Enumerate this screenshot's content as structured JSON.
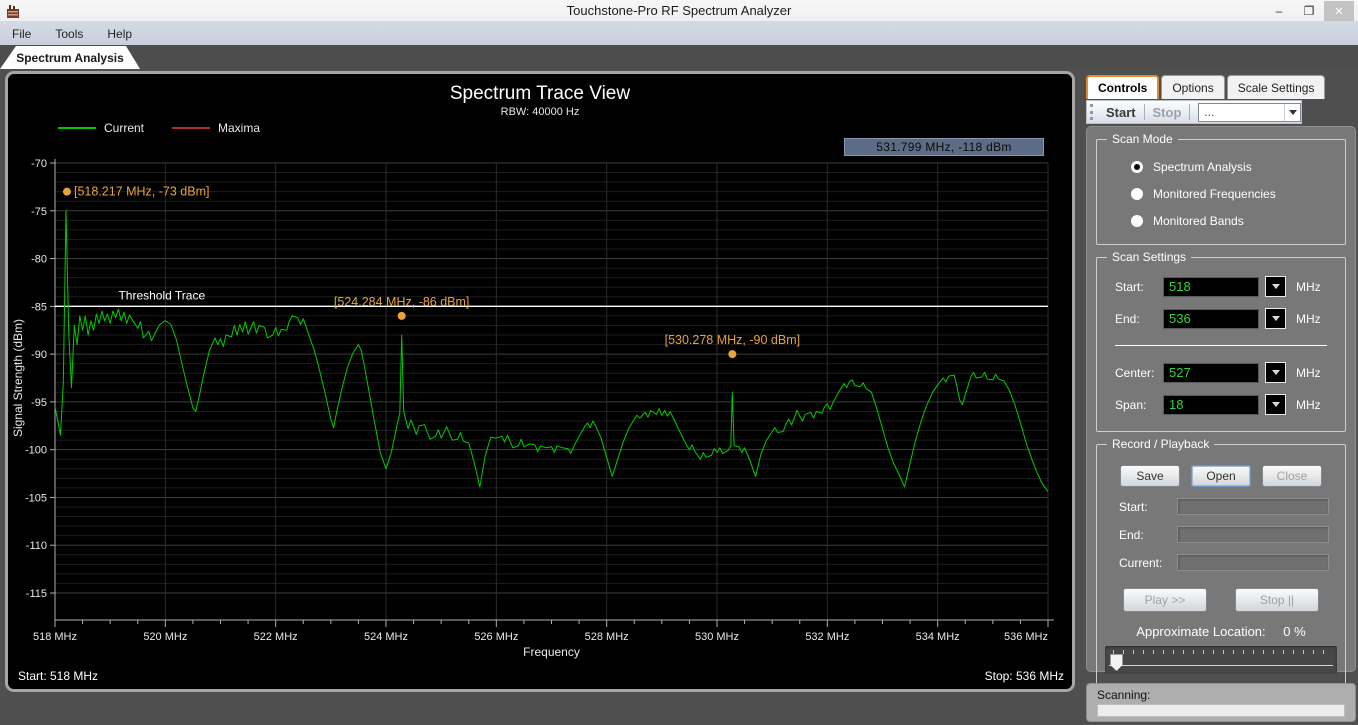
{
  "window": {
    "title": "Touchstone-Pro RF Spectrum Analyzer",
    "controls": {
      "minimize": "–",
      "restore": "❐",
      "close": "✕"
    }
  },
  "menu": {
    "items": [
      "File",
      "Tools",
      "Help"
    ]
  },
  "main_tab": "Spectrum Analysis",
  "chart_data": {
    "type": "line",
    "title": "Spectrum Trace View",
    "subtitle": "RBW: 40000 Hz",
    "xlabel": "Frequency",
    "ylabel": "Signal Strength (dBm)",
    "x_unit": "MHz",
    "xlim": [
      518,
      536
    ],
    "ylim": [
      -115,
      -70
    ],
    "x_major_tick": 2,
    "x_minor_tick": 0.5,
    "y_major_tick": 5,
    "y_minor_tick": 1,
    "grid": true,
    "legend_position": "top-left",
    "legend": [
      {
        "label": "Current",
        "color": "#00c800"
      },
      {
        "label": "Maxima",
        "color": "#a83232"
      }
    ],
    "cursor_readout": "531.799 MHz,  -118 dBm",
    "start_text": "Start: 518 MHz",
    "stop_text": "Stop: 536 MHz",
    "annotation_color": "#e8a33c",
    "annotations": [
      {
        "text": "[518.217 MHz, -73 dBm]",
        "x": 518.217,
        "y": -73,
        "placement": "right"
      },
      {
        "text": "[524.284 MHz, -86 dBm]",
        "x": 524.284,
        "y": -86,
        "placement": "above"
      },
      {
        "text": "[530.278 MHz, -90 dBm]",
        "x": 530.278,
        "y": -90,
        "placement": "above"
      }
    ],
    "threshold": {
      "label": "Threshold Trace",
      "value": -85,
      "color": "#ffffff",
      "label_x": 519.15
    },
    "series": [
      {
        "name": "Current",
        "color": "#00cc00",
        "points": [
          [
            518.0,
            -95.5
          ],
          [
            518.05,
            -97
          ],
          [
            518.1,
            -98.5
          ],
          [
            518.15,
            -93
          ],
          [
            518.2,
            -75
          ],
          [
            518.25,
            -88
          ],
          [
            518.3,
            -93.5
          ],
          [
            518.35,
            -87
          ],
          [
            518.4,
            -89
          ],
          [
            518.45,
            -86
          ],
          [
            518.5,
            -87.5
          ],
          [
            518.55,
            -86
          ],
          [
            518.6,
            -88
          ],
          [
            518.65,
            -86.5
          ],
          [
            518.7,
            -87.5
          ],
          [
            518.75,
            -85.8
          ],
          [
            518.8,
            -86.8
          ],
          [
            518.85,
            -85.5
          ],
          [
            518.9,
            -86.5
          ],
          [
            518.95,
            -85.8
          ],
          [
            519.0,
            -86.8
          ],
          [
            519.05,
            -85.5
          ],
          [
            519.1,
            -86.2
          ],
          [
            519.15,
            -85.3
          ],
          [
            519.2,
            -86.5
          ],
          [
            519.25,
            -85.6
          ],
          [
            519.3,
            -86.8
          ],
          [
            519.35,
            -85.9
          ],
          [
            519.4,
            -86.4
          ],
          [
            519.5,
            -87.3
          ],
          [
            519.55,
            -86.6
          ],
          [
            519.6,
            -88.3
          ],
          [
            519.7,
            -87.6
          ],
          [
            519.75,
            -88.6
          ],
          [
            519.85,
            -87.4
          ],
          [
            519.9,
            -86.9
          ],
          [
            520.0,
            -86.5
          ],
          [
            520.1,
            -86.9
          ],
          [
            520.2,
            -88.5
          ],
          [
            520.3,
            -91
          ],
          [
            520.4,
            -93.4
          ],
          [
            520.5,
            -95.6
          ],
          [
            520.55,
            -96
          ],
          [
            520.6,
            -94.8
          ],
          [
            520.7,
            -92
          ],
          [
            520.8,
            -89.6
          ],
          [
            520.9,
            -88.3
          ],
          [
            520.95,
            -89
          ],
          [
            521.0,
            -88.4
          ],
          [
            521.05,
            -89.2
          ],
          [
            521.1,
            -88
          ],
          [
            521.2,
            -88.2
          ],
          [
            521.25,
            -87
          ],
          [
            521.3,
            -88
          ],
          [
            521.35,
            -86.9
          ],
          [
            521.4,
            -87.7
          ],
          [
            521.45,
            -86.6
          ],
          [
            521.5,
            -87.9
          ],
          [
            521.6,
            -86.6
          ],
          [
            521.65,
            -87.8
          ],
          [
            521.7,
            -87
          ],
          [
            521.8,
            -87.2
          ],
          [
            521.85,
            -88.3
          ],
          [
            521.95,
            -88
          ],
          [
            522.0,
            -87.2
          ],
          [
            522.05,
            -88.1
          ],
          [
            522.1,
            -87.4
          ],
          [
            522.2,
            -87.5
          ],
          [
            522.25,
            -86.5
          ],
          [
            522.3,
            -86
          ],
          [
            522.4,
            -86.2
          ],
          [
            522.45,
            -86.9
          ],
          [
            522.5,
            -86.3
          ],
          [
            522.6,
            -88
          ],
          [
            522.7,
            -89.6
          ],
          [
            522.8,
            -91.8
          ],
          [
            522.9,
            -94.2
          ],
          [
            523.0,
            -96.8
          ],
          [
            523.05,
            -97.7
          ],
          [
            523.1,
            -96.2
          ],
          [
            523.2,
            -93.6
          ],
          [
            523.3,
            -91.4
          ],
          [
            523.4,
            -89.9
          ],
          [
            523.5,
            -89
          ],
          [
            523.55,
            -89.6
          ],
          [
            523.6,
            -91
          ],
          [
            523.7,
            -94.2
          ],
          [
            523.8,
            -97.4
          ],
          [
            523.9,
            -100.4
          ],
          [
            524.0,
            -102
          ],
          [
            524.1,
            -100.2
          ],
          [
            524.2,
            -97.4
          ],
          [
            524.25,
            -96.2
          ],
          [
            524.284,
            -88
          ],
          [
            524.32,
            -96
          ],
          [
            524.4,
            -97.8
          ],
          [
            524.45,
            -96.9
          ],
          [
            524.5,
            -97.6
          ],
          [
            524.55,
            -98.4
          ],
          [
            524.6,
            -97.5
          ],
          [
            524.7,
            -97.4
          ],
          [
            524.75,
            -98.2
          ],
          [
            524.8,
            -98.9
          ],
          [
            524.9,
            -98.6
          ],
          [
            524.95,
            -97.9
          ],
          [
            525.0,
            -98.8
          ],
          [
            525.1,
            -97.6
          ],
          [
            525.2,
            -99
          ],
          [
            525.3,
            -98.9
          ],
          [
            525.35,
            -98.2
          ],
          [
            525.4,
            -99.1
          ],
          [
            525.5,
            -99.3
          ],
          [
            525.6,
            -101.4
          ],
          [
            525.7,
            -103.9
          ],
          [
            525.8,
            -100.6
          ],
          [
            525.9,
            -98.7
          ],
          [
            526.0,
            -98.8
          ],
          [
            526.1,
            -98.6
          ],
          [
            526.15,
            -99.2
          ],
          [
            526.2,
            -98.5
          ],
          [
            526.3,
            -99.8
          ],
          [
            526.4,
            -99.6
          ],
          [
            526.45,
            -98.9
          ],
          [
            526.5,
            -99.7
          ],
          [
            526.6,
            -99.4
          ],
          [
            526.7,
            -99.5
          ],
          [
            526.75,
            -100.2
          ],
          [
            526.8,
            -99.6
          ],
          [
            526.9,
            -99.8
          ],
          [
            527.0,
            -99.7
          ],
          [
            527.05,
            -100.3
          ],
          [
            527.1,
            -99.6
          ],
          [
            527.2,
            -99.8
          ],
          [
            527.3,
            -99.9
          ],
          [
            527.35,
            -100.4
          ],
          [
            527.4,
            -99.7
          ],
          [
            527.5,
            -98.6
          ],
          [
            527.6,
            -97.6
          ],
          [
            527.65,
            -97.2
          ],
          [
            527.7,
            -97.7
          ],
          [
            527.75,
            -97
          ],
          [
            527.8,
            -97.5
          ],
          [
            527.9,
            -98.8
          ],
          [
            528.0,
            -100.8
          ],
          [
            528.1,
            -102.8
          ],
          [
            528.2,
            -101
          ],
          [
            528.3,
            -99.2
          ],
          [
            528.4,
            -97.8
          ],
          [
            528.5,
            -96.8
          ],
          [
            528.55,
            -96.4
          ],
          [
            528.6,
            -96.7
          ],
          [
            528.7,
            -96.1
          ],
          [
            528.75,
            -96.6
          ],
          [
            528.8,
            -95.9
          ],
          [
            528.9,
            -96.3
          ],
          [
            528.95,
            -95.7
          ],
          [
            529.0,
            -96.4
          ],
          [
            529.05,
            -95.9
          ],
          [
            529.1,
            -96.5
          ],
          [
            529.15,
            -96
          ],
          [
            529.2,
            -96.6
          ],
          [
            529.3,
            -97.8
          ],
          [
            529.4,
            -99
          ],
          [
            529.5,
            -100
          ],
          [
            529.55,
            -99.5
          ],
          [
            529.6,
            -100.2
          ],
          [
            529.7,
            -101
          ],
          [
            529.75,
            -100.3
          ],
          [
            529.8,
            -100.8
          ],
          [
            529.9,
            -100.6
          ],
          [
            529.95,
            -99.9
          ],
          [
            530.0,
            -100.3
          ],
          [
            530.05,
            -99.8
          ],
          [
            530.1,
            -100.4
          ],
          [
            530.2,
            -100.1
          ],
          [
            530.25,
            -99.6
          ],
          [
            530.278,
            -94
          ],
          [
            530.31,
            -99.6
          ],
          [
            530.4,
            -99.7
          ],
          [
            530.45,
            -100.3
          ],
          [
            530.5,
            -99.8
          ],
          [
            530.6,
            -101.2
          ],
          [
            530.7,
            -102.8
          ],
          [
            530.8,
            -100.4
          ],
          [
            530.9,
            -99
          ],
          [
            531.0,
            -98.1
          ],
          [
            531.05,
            -97.7
          ],
          [
            531.1,
            -98.2
          ],
          [
            531.2,
            -98.1
          ],
          [
            531.25,
            -97.3
          ],
          [
            531.3,
            -96.8
          ],
          [
            531.35,
            -97.4
          ],
          [
            531.4,
            -96.7
          ],
          [
            531.45,
            -95.9
          ],
          [
            531.5,
            -96.5
          ],
          [
            531.55,
            -97
          ],
          [
            531.6,
            -96.3
          ],
          [
            531.7,
            -96.1
          ],
          [
            531.75,
            -96.7
          ],
          [
            531.8,
            -96
          ],
          [
            531.9,
            -96.2
          ],
          [
            531.95,
            -95.5
          ],
          [
            532.0,
            -95.2
          ],
          [
            532.05,
            -95.8
          ],
          [
            532.1,
            -95.1
          ],
          [
            532.2,
            -94
          ],
          [
            532.3,
            -93.1
          ],
          [
            532.35,
            -93.5
          ],
          [
            532.4,
            -92.9
          ],
          [
            532.45,
            -92.7
          ],
          [
            532.5,
            -93.3
          ],
          [
            532.6,
            -93.4
          ],
          [
            532.65,
            -93
          ],
          [
            532.7,
            -93.6
          ],
          [
            532.8,
            -94
          ],
          [
            532.9,
            -95.8
          ],
          [
            533.0,
            -97.8
          ],
          [
            533.1,
            -99.8
          ],
          [
            533.2,
            -101.4
          ],
          [
            533.3,
            -102.6
          ],
          [
            533.4,
            -103.9
          ],
          [
            533.5,
            -101.4
          ],
          [
            533.6,
            -99
          ],
          [
            533.7,
            -97
          ],
          [
            533.8,
            -95.4
          ],
          [
            533.9,
            -94.1
          ],
          [
            534.0,
            -93.2
          ],
          [
            534.1,
            -92.5
          ],
          [
            534.15,
            -92.9
          ],
          [
            534.2,
            -92.3
          ],
          [
            534.3,
            -92.2
          ],
          [
            534.35,
            -93.4
          ],
          [
            534.4,
            -94.8
          ],
          [
            534.45,
            -95.3
          ],
          [
            534.5,
            -94.2
          ],
          [
            534.6,
            -92.4
          ],
          [
            534.65,
            -91.9
          ],
          [
            534.7,
            -92.5
          ],
          [
            534.8,
            -92.4
          ],
          [
            534.85,
            -91.9
          ],
          [
            534.9,
            -92.6
          ],
          [
            535.0,
            -92.7
          ],
          [
            535.05,
            -92.1
          ],
          [
            535.1,
            -92.6
          ],
          [
            535.2,
            -92.8
          ],
          [
            535.3,
            -93.8
          ],
          [
            535.4,
            -95.3
          ],
          [
            535.5,
            -97.2
          ],
          [
            535.6,
            -99.2
          ],
          [
            535.7,
            -100.9
          ],
          [
            535.8,
            -102.4
          ],
          [
            535.9,
            -103.6
          ],
          [
            536.0,
            -104.4
          ]
        ]
      }
    ]
  },
  "panel": {
    "tabs": [
      {
        "label": "Controls",
        "active": true
      },
      {
        "label": "Options",
        "active": false
      },
      {
        "label": "Scale Settings",
        "active": false
      }
    ],
    "toolbar": {
      "start": {
        "label": "Start"
      },
      "stop": {
        "label": "Stop",
        "disabled": true
      },
      "preset": {
        "value": "..."
      }
    },
    "scan_mode": {
      "title": "Scan Mode",
      "options": [
        {
          "label": "Spectrum Analysis",
          "selected": true
        },
        {
          "label": "Monitored Frequencies",
          "selected": false
        },
        {
          "label": "Monitored Bands",
          "selected": false
        }
      ]
    },
    "scan_settings": {
      "title": "Scan Settings",
      "fields": [
        {
          "label": "Start:",
          "value": "518",
          "unit": "MHz"
        },
        {
          "label": "End:",
          "value": "536",
          "unit": "MHz"
        },
        {
          "label": "Center:",
          "value": "527",
          "unit": "MHz"
        },
        {
          "label": "Span:",
          "value": "18",
          "unit": "MHz"
        }
      ]
    },
    "record_playback": {
      "title": "Record / Playback",
      "buttons": [
        {
          "label": "Save"
        },
        {
          "label": "Open",
          "focused": true
        },
        {
          "label": "Close",
          "disabled": true
        }
      ],
      "fields": [
        {
          "label": "Start:",
          "value": ""
        },
        {
          "label": "End:",
          "value": ""
        },
        {
          "label": "Current:",
          "value": ""
        }
      ],
      "play": {
        "label": "Play >>",
        "disabled": true
      },
      "stop": {
        "label": "Stop ||",
        "disabled": true
      },
      "location_label": "Approximate Location:",
      "location_value": "0 %"
    }
  },
  "status": {
    "label": "Scanning:",
    "progress_percent": 0
  }
}
